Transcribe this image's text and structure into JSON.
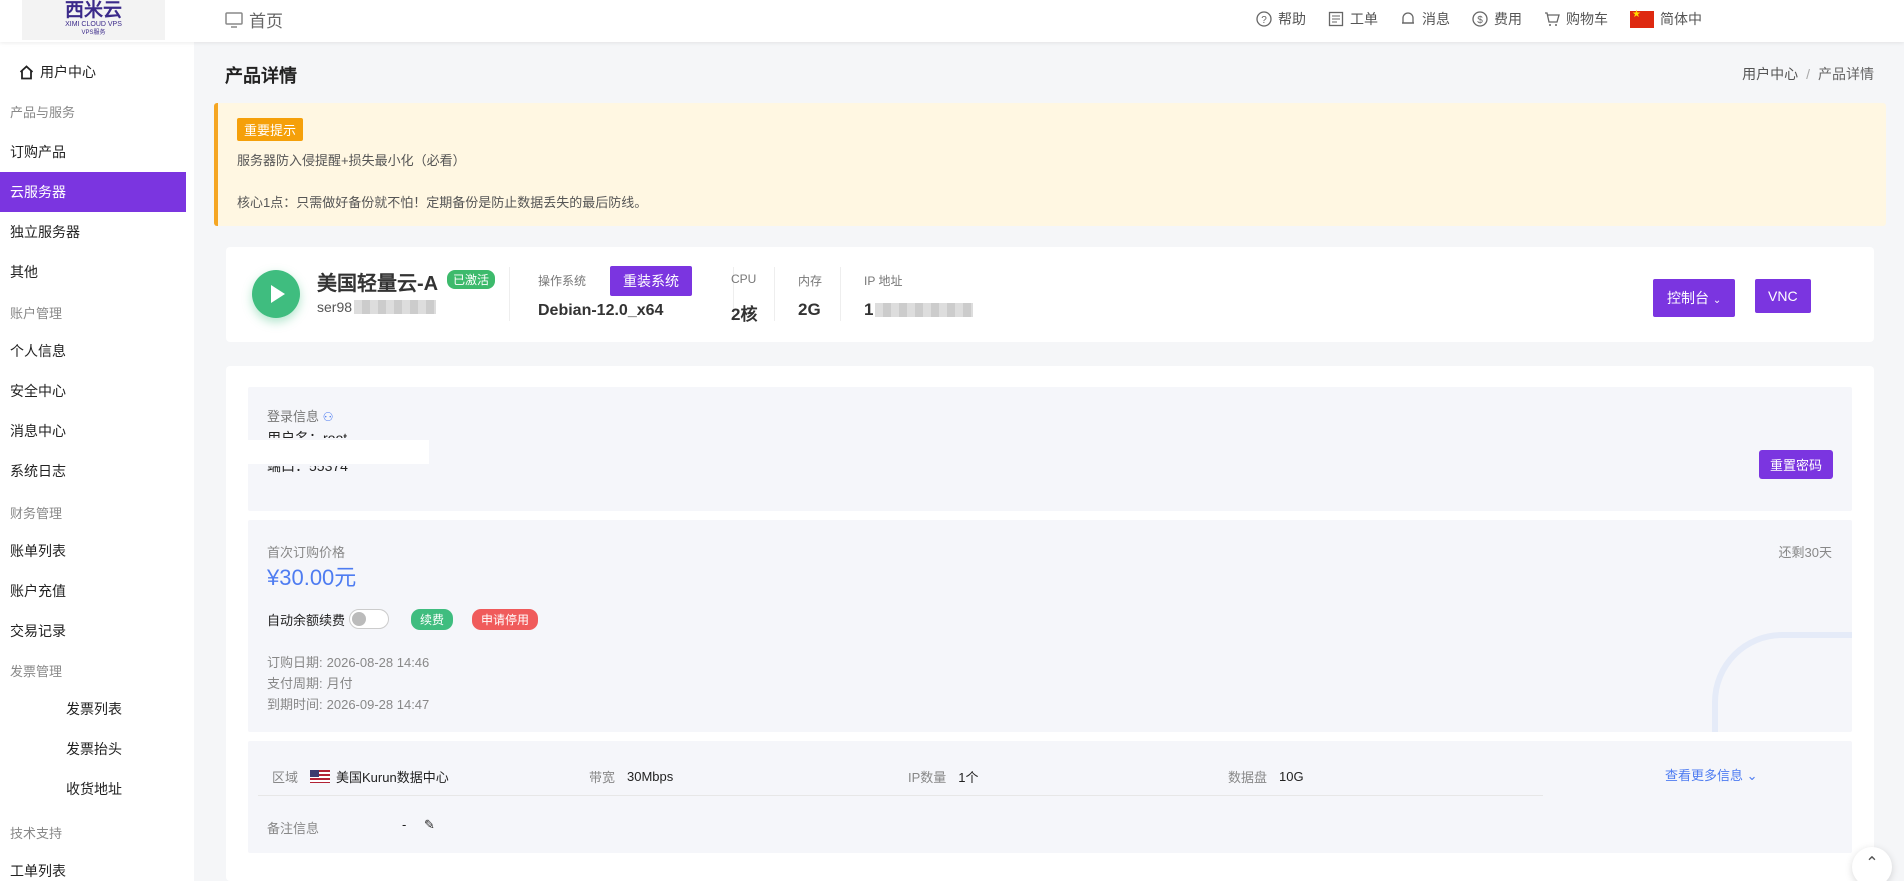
{
  "logo": {
    "main": "西米云",
    "sub1": "XIMI CLOUD VPS",
    "sub2": "VPS服务"
  },
  "topbar": {
    "home": "首页",
    "help": "帮助",
    "ticket": "工单",
    "message": "消息",
    "fee": "费用",
    "cart": "购物车",
    "language": "简体中"
  },
  "sidebar": {
    "user_center": "用户中心",
    "group_products": "产品与服务",
    "order_product": "订购产品",
    "cloud_server": "云服务器",
    "dedicated_server": "独立服务器",
    "other": "其他",
    "group_account": "账户管理",
    "personal_info": "个人信息",
    "security_center": "安全中心",
    "message_center": "消息中心",
    "system_log": "系统日志",
    "group_finance": "财务管理",
    "bill_list": "账单列表",
    "account_recharge": "账户充值",
    "transaction_record": "交易记录",
    "group_invoice": "发票管理",
    "invoice_list": "发票列表",
    "invoice_title": "发票抬头",
    "shipping_address": "收货地址",
    "group_support": "技术支持",
    "ticket_list": "工单列表"
  },
  "page": {
    "title": "产品详情",
    "breadcrumb_home": "用户中心",
    "breadcrumb_sep": "/",
    "breadcrumb_current": "产品详情"
  },
  "notice": {
    "tag": "重要提示",
    "line1": "服务器防入侵提醒+损失最小化（必看）",
    "line2": "核心1点：只需做好备份就不怕！定期备份是防止数据丢失的最后防线。"
  },
  "product": {
    "name": "美国轻量云-A",
    "status": "已激活",
    "id_prefix": "ser98",
    "os_label": "操作系统",
    "reinstall": "重装系统",
    "os_value": "Debian-12.0_x64",
    "cpu_label": "CPU",
    "cpu_value": "2核",
    "mem_label": "内存",
    "mem_value": "2G",
    "ip_label": "IP 地址",
    "ip_prefix": "1",
    "console": "控制台",
    "vnc": "VNC"
  },
  "login": {
    "label": "登录信息",
    "username": "用户名：root",
    "port": "端口：55374",
    "reset": "重置密码"
  },
  "billing": {
    "price_label": "首次订购价格",
    "price": "¥30.00元",
    "remaining": "还剩30天",
    "auto_renew": "自动余额续费",
    "renew": "续费",
    "apply_stop": "申请停用",
    "order_date_label": "订购日期:",
    "order_date": "2026-08-28 14:46",
    "cycle_label": "支付周期:",
    "cycle": "月付",
    "expire_label": "到期时间:",
    "expire": "2026-09-28 14:47"
  },
  "specs": {
    "region_label": "区域",
    "region": "美国Kurun数据中心",
    "bandwidth_label": "带宽",
    "bandwidth": "30Mbps",
    "ip_count_label": "IP数量",
    "ip_count": "1个",
    "disk_label": "数据盘",
    "disk": "10G",
    "more": "查看更多信息",
    "remark_label": "备注信息",
    "remark": "-"
  }
}
